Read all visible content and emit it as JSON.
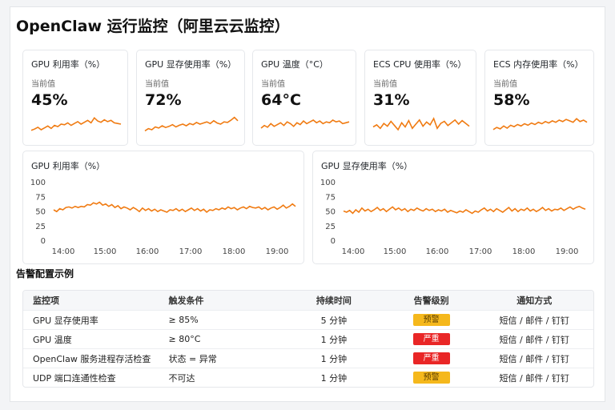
{
  "page": {
    "title": "OpenClaw 运行监控（阿里云云监控）"
  },
  "colors": {
    "line": "#f07b12",
    "warn": "#f5b81c",
    "crit": "#e92626"
  },
  "stat_cards": [
    {
      "title": "GPU 利用率（%）",
      "sub": "当前值",
      "value": "45%",
      "spark": [
        50,
        52,
        55,
        51,
        54,
        57,
        53,
        58,
        56,
        60,
        59,
        62,
        58,
        61,
        64,
        60,
        63,
        66,
        62,
        70,
        65,
        63,
        67,
        64,
        66,
        62,
        61,
        60
      ]
    },
    {
      "title": "GPU 显存使用率（%）",
      "sub": "当前值",
      "value": "72%",
      "spark": [
        48,
        52,
        50,
        55,
        53,
        57,
        54,
        56,
        59,
        55,
        58,
        60,
        57,
        61,
        59,
        63,
        60,
        62,
        64,
        61,
        66,
        62,
        60,
        64,
        63,
        67,
        72,
        66
      ]
    },
    {
      "title": "GPU 温度（°C）",
      "sub": "当前值",
      "value": "64°C",
      "spark": [
        55,
        58,
        56,
        60,
        57,
        59,
        61,
        58,
        62,
        60,
        57,
        61,
        59,
        63,
        60,
        62,
        64,
        61,
        63,
        60,
        62,
        61,
        64,
        62,
        63,
        60,
        61,
        62
      ]
    },
    {
      "title": "ECS CPU 使用率（%）",
      "sub": "当前值",
      "value": "31%",
      "spark": [
        52,
        55,
        50,
        57,
        53,
        60,
        54,
        48,
        58,
        52,
        61,
        50,
        56,
        62,
        53,
        59,
        55,
        64,
        50,
        57,
        60,
        54,
        58,
        62,
        56,
        61,
        57,
        53
      ]
    },
    {
      "title": "ECS 内存使用率（%）",
      "sub": "当前值",
      "value": "58%",
      "spark": [
        50,
        53,
        51,
        55,
        52,
        56,
        54,
        57,
        55,
        58,
        56,
        59,
        57,
        60,
        58,
        61,
        59,
        62,
        60,
        63,
        61,
        64,
        62,
        60,
        65,
        61,
        63,
        60
      ]
    }
  ],
  "chart_data": [
    {
      "type": "line",
      "title": "GPU 利用率（%）",
      "ylim": [
        0,
        100
      ],
      "yticks": [
        "0",
        "25",
        "50",
        "75",
        "100"
      ],
      "xticks": [
        "14:00",
        "15:00",
        "16:00",
        "17:00",
        "18:00",
        "19:00"
      ],
      "series": [
        {
          "values": [
            52,
            49,
            54,
            52,
            56,
            57,
            55,
            58,
            56,
            58,
            57,
            61,
            60,
            64,
            62,
            65,
            60,
            62,
            58,
            61,
            56,
            59,
            54,
            57,
            55,
            52,
            56,
            53,
            49,
            55,
            51,
            54,
            50,
            53,
            49,
            52,
            50,
            48,
            52,
            51,
            54,
            50,
            53,
            49,
            52,
            55,
            51,
            54,
            50,
            53,
            48,
            52,
            51,
            54,
            52,
            55,
            53,
            57,
            54,
            56,
            52,
            55,
            57,
            54,
            58,
            56,
            55,
            57,
            53,
            56,
            52,
            55,
            57,
            53,
            56,
            60,
            55,
            58,
            62,
            58
          ]
        }
      ]
    },
    {
      "type": "line",
      "title": "GPU 显存使用率（%）",
      "ylim": [
        0,
        100
      ],
      "yticks": [
        "0",
        "25",
        "50",
        "75",
        "100"
      ],
      "xticks": [
        "14:00",
        "15:00",
        "16:00",
        "17:00",
        "18:00",
        "19:00"
      ],
      "series": [
        {
          "values": [
            50,
            48,
            51,
            46,
            52,
            48,
            55,
            50,
            53,
            49,
            52,
            56,
            51,
            54,
            49,
            53,
            57,
            52,
            55,
            51,
            54,
            49,
            53,
            51,
            55,
            52,
            50,
            54,
            51,
            53,
            49,
            52,
            50,
            53,
            48,
            51,
            49,
            47,
            50,
            48,
            52,
            49,
            46,
            50,
            48,
            52,
            55,
            50,
            53,
            49,
            54,
            51,
            48,
            52,
            56,
            50,
            54,
            49,
            53,
            51,
            55,
            50,
            53,
            49,
            52,
            56,
            51,
            54,
            50,
            53,
            52,
            55,
            51,
            54,
            57,
            53,
            56,
            58,
            55,
            53
          ]
        }
      ]
    }
  ],
  "alerts": {
    "section_title": "告警配置示例",
    "headers": [
      "监控项",
      "触发条件",
      "持续时间",
      "告警级别",
      "通知方式"
    ],
    "rows": [
      {
        "item": "GPU 显存使用率",
        "cond": "≥ 85%",
        "dur": "5 分钟",
        "level": "预警",
        "level_type": "warn",
        "notify": "短信 / 邮件 / 钉钉"
      },
      {
        "item": "GPU 温度",
        "cond": "≥ 80°C",
        "dur": "1 分钟",
        "level": "严重",
        "level_type": "crit",
        "notify": "短信 / 邮件 / 钉钉"
      },
      {
        "item": "OpenClaw 服务进程存活检查",
        "cond": "状态 = 异常",
        "dur": "1 分钟",
        "level": "严重",
        "level_type": "crit",
        "notify": "短信 / 邮件 / 钉钉"
      },
      {
        "item": "UDP 端口连通性检查",
        "cond": "不可达",
        "dur": "1 分钟",
        "level": "预警",
        "level_type": "warn",
        "notify": "短信 / 邮件 / 钉钉"
      }
    ]
  }
}
